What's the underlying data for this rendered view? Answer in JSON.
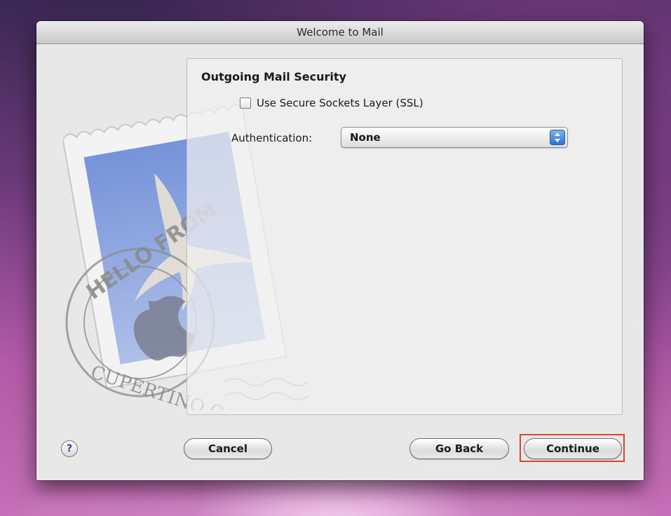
{
  "window": {
    "title": "Welcome to Mail"
  },
  "panel": {
    "section_title": "Outgoing Mail Security",
    "ssl_checkbox": {
      "label": "Use Secure Sockets Layer (SSL)",
      "checked": false
    },
    "authentication": {
      "label": "Authentication:",
      "selected": "None"
    }
  },
  "stamp": {
    "postmark_text_top": "HELLO FROM",
    "postmark_text_bottom": "CUPERTINO CA",
    "icon": "mail-stamp-eagle-icon"
  },
  "footer": {
    "help_label": "?",
    "cancel_label": "Cancel",
    "go_back_label": "Go Back",
    "continue_label": "Continue"
  },
  "colors": {
    "highlight": "#e0442f",
    "popup_arrows": "#2b6fd8",
    "help_icon": "#5a2a9c"
  }
}
